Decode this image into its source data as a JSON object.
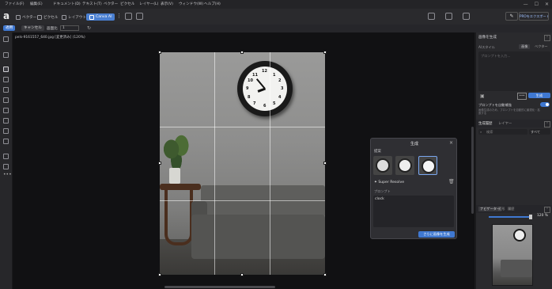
{
  "menu": [
    "ファイル(F)",
    "編集(E)",
    "ドキュメント(D)",
    "テキスト(T)",
    "ベクター",
    "ピクセル",
    "レイヤー(L)",
    "表示(V)",
    "ウィンドウ(W)",
    "ヘルプ(H)"
  ],
  "modes": [
    {
      "label": "ベクター",
      "icon": "pen-tool-icon"
    },
    {
      "label": "ピクセル",
      "icon": "brush-icon"
    },
    {
      "label": "レイアウト",
      "icon": "layout-icon"
    },
    {
      "label": "Canva AI",
      "icon": "sparkle-icon"
    }
  ],
  "share_label": "PROをエクスポート",
  "optbar": {
    "apply": "適用",
    "cancel": "キャンセル",
    "ratio_label": "画面比",
    "ratio_value": "1"
  },
  "doc_tab": "pels-9161557_640.jpg [変更済み] (120%)",
  "popup": {
    "title": "生成",
    "section_label": "提案",
    "model_name": "Super Resolve",
    "prompt_label": "プロンプト",
    "prompt_value": "clock",
    "generate_btn": "さらに画像を生成"
  },
  "right": {
    "gen_title": "画像を生成",
    "style_label": "AIスタイル",
    "style_tabs": [
      "画像",
      "ベクター"
    ],
    "prompt_placeholder": "プロンプトを入力...",
    "generate": "生成",
    "toggle_label": "プロンプトを自動補強",
    "toggle_desc": "画像生成のため、プロンプトを自動的に最適化・拡張する",
    "tabs": [
      "生成履歴",
      "レイヤー"
    ],
    "search_placeholder": "検索",
    "filter": "すべて",
    "nav_tabs": [
      "ナビゲーター",
      "変形",
      "履歴"
    ],
    "zoom": "120 %"
  },
  "window_buttons": [
    "—",
    "☐",
    "✕"
  ],
  "colors": {
    "accent": "#3f78d1",
    "bg": "#1b1b1d"
  }
}
